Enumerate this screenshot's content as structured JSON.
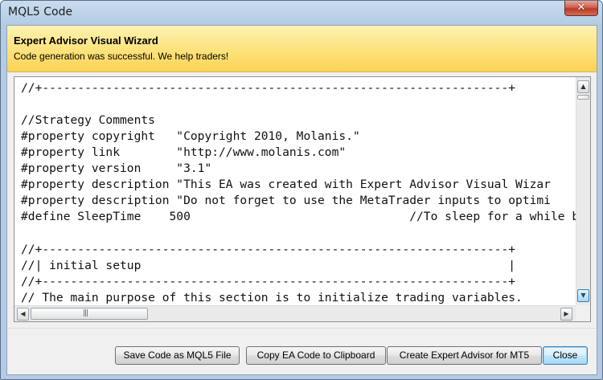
{
  "window": {
    "title": "MQL5 Code",
    "close_glyph": "✕"
  },
  "banner": {
    "title": "Expert Advisor Visual Wizard",
    "subtitle": "Code generation was successful. We help traders!"
  },
  "code_lines": [
    "//+------------------------------------------------------------------+",
    "",
    "",
    "//Strategy Comments",
    "#property copyright   \"Copyright 2010, Molanis.\"",
    "#property link        \"http://www.molanis.com\"",
    "#property version     \"3.1\"",
    "#property description \"This EA was created with Expert Advisor Visual Wizar",
    "#property description \"Do not forget to use the MetaTrader inputs to optimi",
    "#define SleepTime    500                               //To sleep for a while b",
    "",
    "//+------------------------------------------------------------------+",
    "//| initial setup                                                    |",
    "//+------------------------------------------------------------------+",
    "// The main purpose of this section is to initialize trading variables."
  ],
  "scrollbars": {
    "up_arrow": "▲",
    "down_arrow": "▼",
    "left_arrow": "◀",
    "right_arrow": "▶",
    "grip": "|||"
  },
  "buttons": {
    "save": "Save Code as MQL5 File",
    "copy": "Copy EA Code to Clipboard",
    "create": "Create Expert Advisor for MT5",
    "close": "Close"
  }
}
